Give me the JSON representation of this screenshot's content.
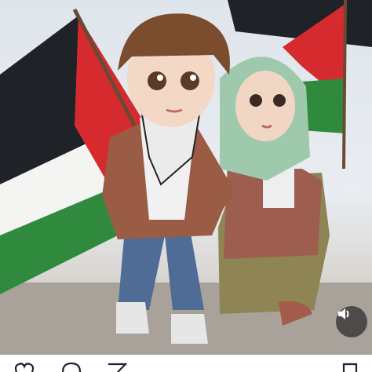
{
  "post": {
    "image_subject": "",
    "flag_colors": {
      "black": "#1f2226",
      "white": "#f4f4f2",
      "green": "#2f8a3e",
      "red": "#d62b2e"
    }
  },
  "controls": {
    "sound_icon": "speaker-icon",
    "action_icons": [
      "heart-icon",
      "comment-icon",
      "share-icon",
      "bookmark-icon"
    ]
  }
}
